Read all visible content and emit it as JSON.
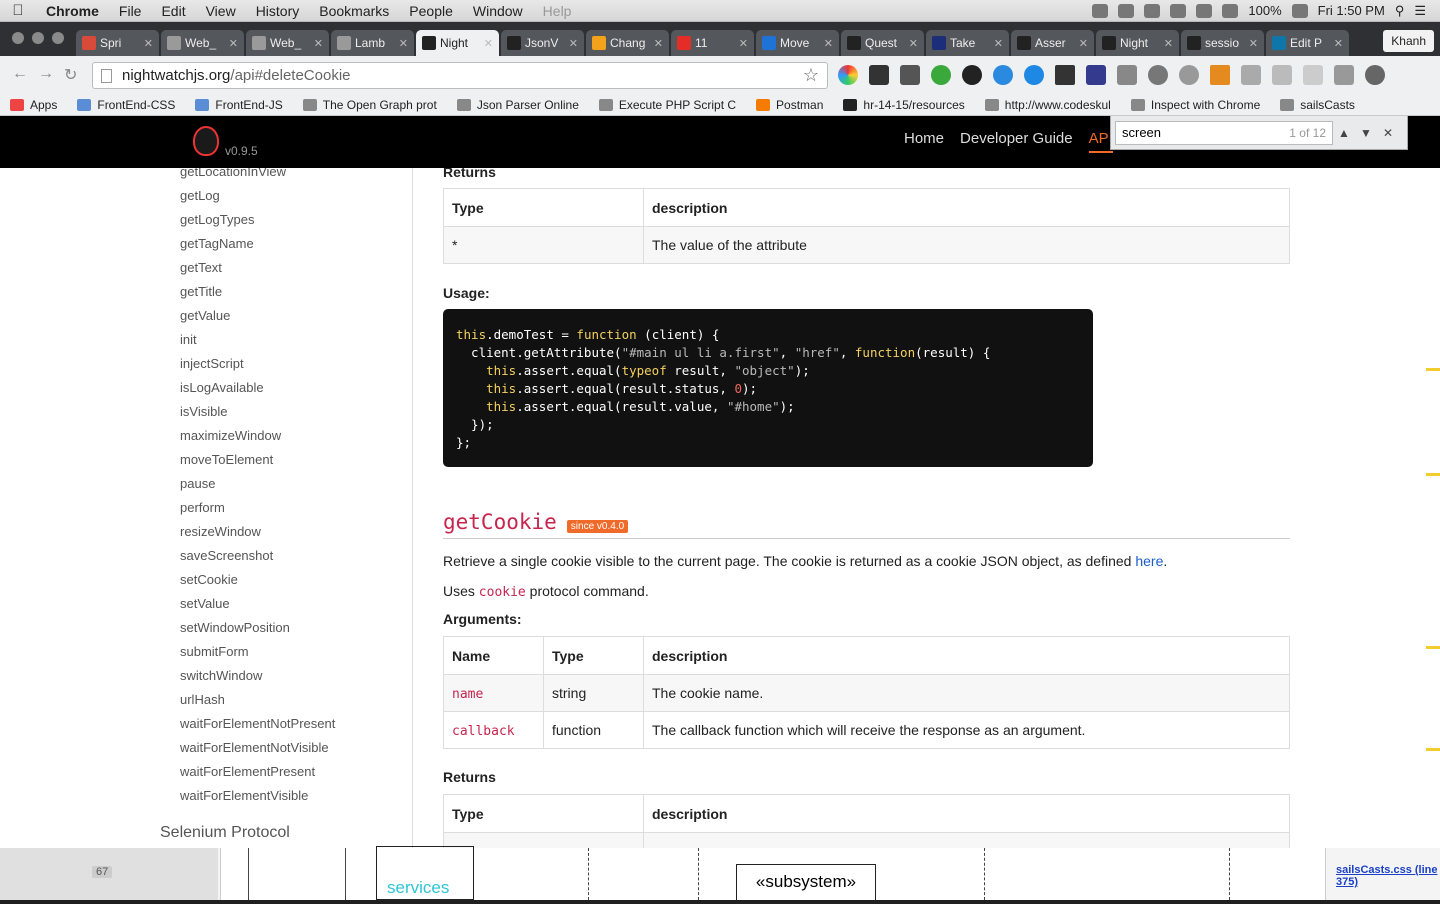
{
  "menubar": {
    "items": [
      "Chrome",
      "File",
      "Edit",
      "View",
      "History",
      "Bookmarks",
      "People",
      "Window",
      "Help"
    ],
    "battery": "100%",
    "clock": "Fri 1:50 PM"
  },
  "tabs": [
    {
      "label": "Spri",
      "color": "#d84a3a"
    },
    {
      "label": "Web_",
      "color": "#9a9a9a"
    },
    {
      "label": "Web_",
      "color": "#9a9a9a"
    },
    {
      "label": "Lamb",
      "color": "#9a9a9a"
    },
    {
      "label": "Night",
      "color": "#222222"
    },
    {
      "label": "JsonV",
      "color": "#222222"
    },
    {
      "label": "Chang",
      "color": "#f2a21b"
    },
    {
      "label": "11",
      "color": "#e52d27"
    },
    {
      "label": "Move",
      "color": "#1f73d6"
    },
    {
      "label": "Quest",
      "color": "#222222"
    },
    {
      "label": "Take",
      "color": "#1c2e7a"
    },
    {
      "label": "Asser",
      "color": "#222222"
    },
    {
      "label": "Night",
      "color": "#222222"
    },
    {
      "label": "sessio",
      "color": "#222222"
    },
    {
      "label": "Edit P",
      "color": "#0e76a8"
    }
  ],
  "profile": "Khanh",
  "omnibox": {
    "host": "nightwatchjs.org",
    "path": "/api#deleteCookie"
  },
  "bookmarks": [
    "Apps",
    "FrontEnd-CSS",
    "FrontEnd-JS",
    "The Open Graph prot",
    "Json Parser Online",
    "Execute PHP Script C",
    "Postman",
    "hr-14-15/resources",
    "http://www.codeskul",
    "Inspect with Chrome",
    "sailsCasts"
  ],
  "site": {
    "version": "v0.9.5",
    "nav": [
      "Home",
      "Developer Guide",
      "API"
    ]
  },
  "find": {
    "query": "screen",
    "count": "1 of 12"
  },
  "sidebar": {
    "cut_item": "getLocationInView",
    "items": [
      "getLog",
      "getLogTypes",
      "getTagName",
      "getText",
      "getTitle",
      "getValue",
      "init",
      "injectScript",
      "isLogAvailable",
      "isVisible",
      "maximizeWindow",
      "moveToElement",
      "pause",
      "perform",
      "resizeWindow",
      "saveScreenshot",
      "setCookie",
      "setValue",
      "setWindowPosition",
      "submitForm",
      "switchWindow",
      "urlHash",
      "waitForElementNotPresent",
      "waitForElementNotVisible",
      "waitForElementPresent",
      "waitForElementVisible"
    ],
    "section": "Selenium Protocol"
  },
  "content": {
    "returns_label": "Returns",
    "returns_table": {
      "headers": [
        "Type",
        "description"
      ],
      "row": [
        "*",
        "The value of the attribute"
      ]
    },
    "usage_label": "Usage:",
    "code": {
      "l1a": "this",
      "l1b": ".demoTest = ",
      "l1c": "function",
      "l1d": " (client) {",
      "l2a": "  client.getAttribute(",
      "l2b": "\"#main ul li a.first\"",
      "l2c": ", ",
      "l2d": "\"href\"",
      "l2e": ", ",
      "l2f": "function",
      "l2g": "(result) {",
      "l3a": "    this",
      "l3b": ".assert.equal(",
      "l3c": "typeof",
      "l3d": " result, ",
      "l3e": "\"object\"",
      "l3f": ");",
      "l4a": "    this",
      "l4b": ".assert.equal(result.status, ",
      "l4c": "0",
      "l4d": ");",
      "l5a": "    this",
      "l5b": ".assert.equal(result.value, ",
      "l5c": "\"#home\"",
      "l5d": ");",
      "l6": "  });",
      "l7": "};"
    },
    "heading": "getCookie",
    "badge": "since v0.4.0",
    "desc_pre": "Retrieve a single cookie visible to the current page. The cookie is returned as a cookie JSON object, as defined ",
    "desc_link": "here",
    "desc_post": ".",
    "uses_pre": "Uses ",
    "uses_code": "cookie",
    "uses_post": " protocol command.",
    "args_label": "Arguments:",
    "args_headers": [
      "Name",
      "Type",
      "description"
    ],
    "args": [
      {
        "name": "name",
        "type": "string",
        "desc": "The cookie name."
      },
      {
        "name": "callback",
        "type": "function",
        "desc": "The callback function which will receive the response as an argument."
      }
    ],
    "returns2_label": "Returns",
    "returns2_headers": [
      "Type",
      "description"
    ]
  },
  "background": {
    "page_number": "67",
    "services": "services",
    "subsystem": "«subsystem»",
    "link": "sailsCasts.css (line 375)"
  }
}
